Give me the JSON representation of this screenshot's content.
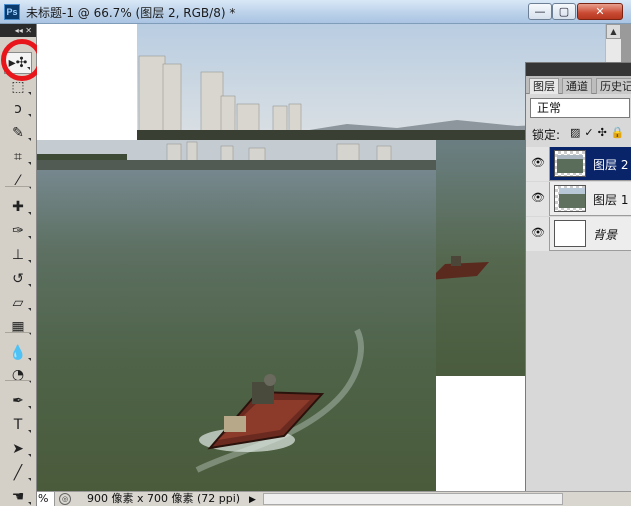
{
  "window": {
    "app_icon": "Ps",
    "title": "未标题-1 @ 66.7% (图层 2, RGB/8) *",
    "buttons": {
      "minimize": "—",
      "maximize": "▢",
      "close": "✕"
    }
  },
  "tools": {
    "header": "◂◂ ✕",
    "items": [
      {
        "name": "move-tool-icon",
        "glyph": "▸✣"
      },
      {
        "name": "marquee-tool-icon",
        "glyph": "⬚"
      },
      {
        "name": "lasso-tool-icon",
        "glyph": "ↄ"
      },
      {
        "name": "quick-selection-tool-icon",
        "glyph": "✎"
      },
      {
        "name": "crop-tool-icon",
        "glyph": "⌗"
      },
      {
        "name": "eyedropper-tool-icon",
        "glyph": "⁄"
      },
      {
        "name": "healing-brush-tool-icon",
        "glyph": "✚"
      },
      {
        "name": "brush-tool-icon",
        "glyph": "✑"
      },
      {
        "name": "clone-stamp-tool-icon",
        "glyph": "⊥"
      },
      {
        "name": "history-brush-tool-icon",
        "glyph": "↺"
      },
      {
        "name": "eraser-tool-icon",
        "glyph": "▱"
      },
      {
        "name": "gradient-tool-icon",
        "glyph": "▦"
      },
      {
        "name": "blur-tool-icon",
        "glyph": "💧"
      },
      {
        "name": "dodge-tool-icon",
        "glyph": "◔"
      },
      {
        "name": "pen-tool-icon",
        "glyph": "✒"
      },
      {
        "name": "type-tool-icon",
        "glyph": "T"
      },
      {
        "name": "path-selection-tool-icon",
        "glyph": "➤"
      },
      {
        "name": "line-tool-icon",
        "glyph": "╱"
      },
      {
        "name": "hand-tool-icon",
        "glyph": "☚"
      }
    ]
  },
  "status": {
    "zoom": "%",
    "doc_size": "900 像素 x 700 像素 (72 ppi)",
    "arrow": "▶"
  },
  "layers_panel": {
    "tabs": [
      "图层",
      "通道",
      "历史记"
    ],
    "blend_mode": "正常",
    "lock_label": "锁定:",
    "lock_icons": "▨✓✣🔒",
    "layers": [
      {
        "name": "图层 2",
        "selected": true
      },
      {
        "name": "图层 1",
        "selected": false
      },
      {
        "name": "背景",
        "selected": false
      }
    ]
  },
  "colors": {
    "selection": "#0a246a",
    "highlight_ring": "#e8161b",
    "water": "#51664b",
    "sky": "#c8d4e0"
  }
}
